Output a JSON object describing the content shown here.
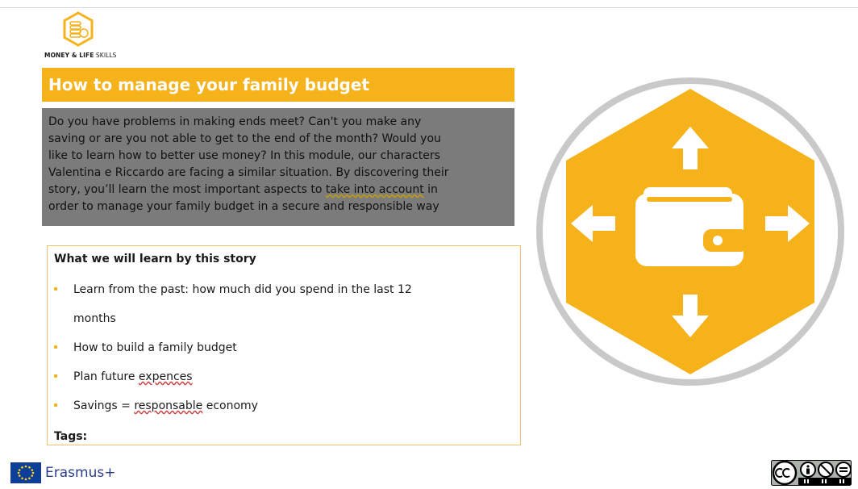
{
  "logo": {
    "bold": "MONEY & LIFE",
    "light": " SKILLS"
  },
  "title": "How to manage your family budget",
  "intro": {
    "before": "Do you have problems in making ends meet? Can't you make any\nsaving or are you not able to get to the end of the month? Would you\nlike to learn how to better use money? In this module, our characters\nValentina e Riccardo are facing a similar situation. By discovering their\nstory, you’ll learn the most important aspects to ",
    "underlined": "take into account",
    "after": " in\norder to manage your family budget in a secure and responsible way"
  },
  "learn": {
    "heading": "What we will learn by this story",
    "items": [
      {
        "text": "Learn from the past: how much did you spend in the last 12"
      },
      {
        "text": "months",
        "continuation": true
      },
      {
        "text": "How to build a family budget"
      },
      {
        "pre": "Plan future ",
        "spell": "expences",
        "post": ""
      },
      {
        "pre": "Savings = ",
        "spell": "responsable",
        "post": " economy"
      }
    ],
    "tags_label": "Tags:"
  },
  "footer": {
    "erasmus": "Erasmus+"
  },
  "colors": {
    "accent": "#f6b21b",
    "intro_bg": "#7b7b7b",
    "ring": "#c9c9c9"
  },
  "icons": [
    "coins-hexagon-logo-icon",
    "wallet-arrows-hexagon-icon",
    "eu-flag-icon",
    "cc-by-nc-nd-icon"
  ]
}
